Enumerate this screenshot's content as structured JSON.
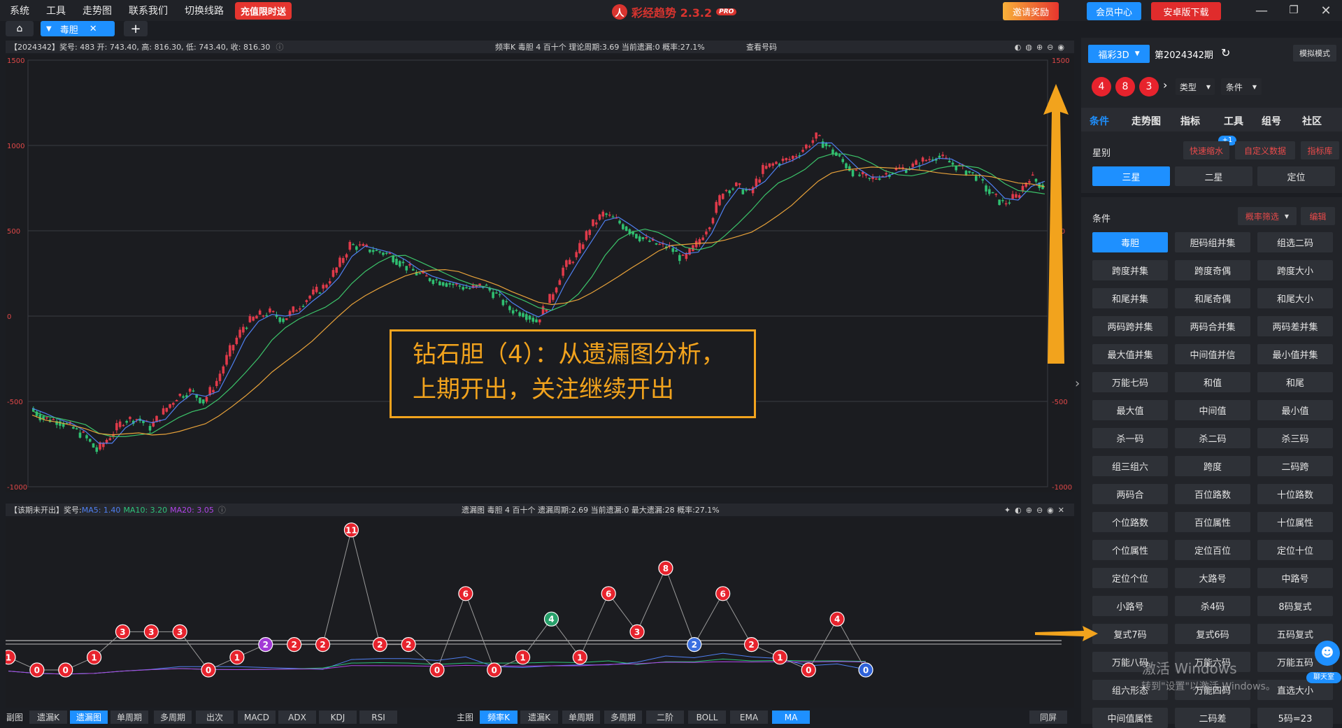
{
  "menu": {
    "system": "系统",
    "tools": "工具",
    "trend": "走势图",
    "contact": "联系我们",
    "switch_line": "切换线路",
    "recharge": "充值限时送"
  },
  "app": {
    "title": "彩经趋势 2.3.2",
    "pro": "PRO",
    "logo": "人"
  },
  "top_buttons": {
    "invite": "邀请奖励",
    "member": "会员中心",
    "android": "安卓版下载"
  },
  "tabs": {
    "active_label": "毒胆",
    "close": "✕",
    "add": "+",
    "home": "⌂"
  },
  "kline_bar": {
    "left": "【2024342】奖号: 483  开: 743.40, 高: 816.30, 低: 743.40, 收: 816.30",
    "mid": "频率K  毒胆  4  百十个  理论周期:3.69  当前遗漏:0  概率:27.1%",
    "check": "查看号码"
  },
  "kline_axis": {
    "left": [
      "1500",
      "1000",
      "500",
      "0",
      "-500",
      "-1000"
    ],
    "right": [
      "1500",
      "1000",
      "500",
      "0",
      "-500",
      "-1000"
    ],
    "right_visible": [
      "1500",
      "1",
      "500",
      "0",
      "-500",
      "-1000"
    ]
  },
  "omission_bar": {
    "left_prefix": "【该期未开出】奖号: ",
    "ma5": "MA5: 1.40",
    "ma10": "MA10: 3.20",
    "ma20": "MA20: 3.05",
    "mid": "遗漏图  毒胆  4  百十个  遗漏周期:2.69  当前遗漏:0  最大遗漏:28  概率:27.1%"
  },
  "callout": {
    "line1": "钻石胆（4）：从遗漏图分析，",
    "line2": "上期开出，关注继续开出"
  },
  "chart_data": [
    {
      "type": "line",
      "title": "频率K",
      "ylim": [
        -1000,
        1500
      ],
      "yticks": [
        1500,
        1000,
        500,
        0,
        -500,
        -1000
      ],
      "series": [
        {
          "name": "",
          "values": [
            -540,
            -600,
            -610,
            -650,
            -700,
            -790,
            -700,
            -610,
            -600,
            -650,
            -560,
            -470,
            -440,
            -500,
            -380,
            -200,
            -60,
            0,
            20,
            -20,
            50,
            120,
            170,
            280,
            420,
            400,
            380,
            360,
            300,
            250,
            220,
            200,
            180,
            160,
            180,
            120,
            40,
            20,
            -30,
            100,
            280,
            360,
            520,
            600,
            560,
            500,
            450,
            420,
            400,
            330,
            420,
            550,
            740,
            760,
            720,
            860,
            900,
            920,
            980,
            1050,
            980,
            900,
            830,
            800,
            830,
            860,
            870,
            910,
            940,
            900,
            860,
            820,
            720,
            660,
            700,
            820,
            760
          ]
        }
      ]
    },
    {
      "type": "line",
      "title": "遗漏图",
      "series": [
        {
          "name": "",
          "values": [
            1,
            0,
            0,
            1,
            3,
            3,
            3,
            0,
            1,
            2,
            2,
            2,
            11,
            2,
            2,
            0,
            6,
            0,
            1,
            4,
            1,
            6,
            3,
            8,
            2,
            6,
            2,
            1,
            0,
            4,
            0
          ]
        }
      ]
    }
  ],
  "bottom_toolbar": {
    "left": [
      "副图",
      "遗漏K",
      "遗漏图",
      "单周期",
      "多周期",
      "出次",
      "MACD",
      "ADX",
      "KDJ",
      "RSI"
    ],
    "right": [
      "主图",
      "频率K",
      "遗漏K",
      "单周期",
      "多周期",
      "二阶",
      "BOLL",
      "EMA",
      "MA"
    ],
    "same": "同屏"
  },
  "side": {
    "lottery": "福彩3D",
    "issue": "第2024342期",
    "sim": "模拟模式",
    "balls": [
      "4",
      "8",
      "3"
    ],
    "type_label": "类型",
    "cond_label": "条件",
    "nav": [
      "条件",
      "走势图",
      "指标",
      "工具",
      "组号",
      "社区"
    ],
    "badge": "+1",
    "star_label": "星别",
    "quick": "快速缩水",
    "custom": "自定义数据",
    "lib": "指标库",
    "stars": [
      "三星",
      "二星",
      "定位"
    ],
    "cond_title": "条件",
    "prob_filter": "概率筛选",
    "edit": "编辑",
    "grid": [
      "毒胆",
      "胆码组并集",
      "组选二码",
      "跨度并集",
      "跨度奇偶",
      "跨度大小",
      "和尾并集",
      "和尾奇偶",
      "和尾大小",
      "两码跨并集",
      "两码合并集",
      "两码差并集",
      "最大值并集",
      "中间值并信",
      "最小值并集",
      "万能七码",
      "和值",
      "和尾",
      "最大值",
      "中间值",
      "最小值",
      "杀一码",
      "杀二码",
      "杀三码",
      "组三组六",
      "跨度",
      "二码跨",
      "两码合",
      "百位路数",
      "十位路数",
      "个位路数",
      "百位属性",
      "十位属性",
      "个位属性",
      "定位百位",
      "定位十位",
      "定位个位",
      "大路号",
      "中路号",
      "小路号",
      "杀4码",
      "8码复式",
      "复式7码",
      "复式6码",
      "五码复式",
      "万能八码",
      "万能六码",
      "万能五码",
      "组六形态",
      "万能四码",
      "直选大小",
      "中间值属性",
      "二码差",
      "5码=23"
    ],
    "chat": "聊天室"
  },
  "watermark": {
    "line1": "激活 Windows",
    "line2": "转到\"设置\"以激活 Windows。"
  }
}
